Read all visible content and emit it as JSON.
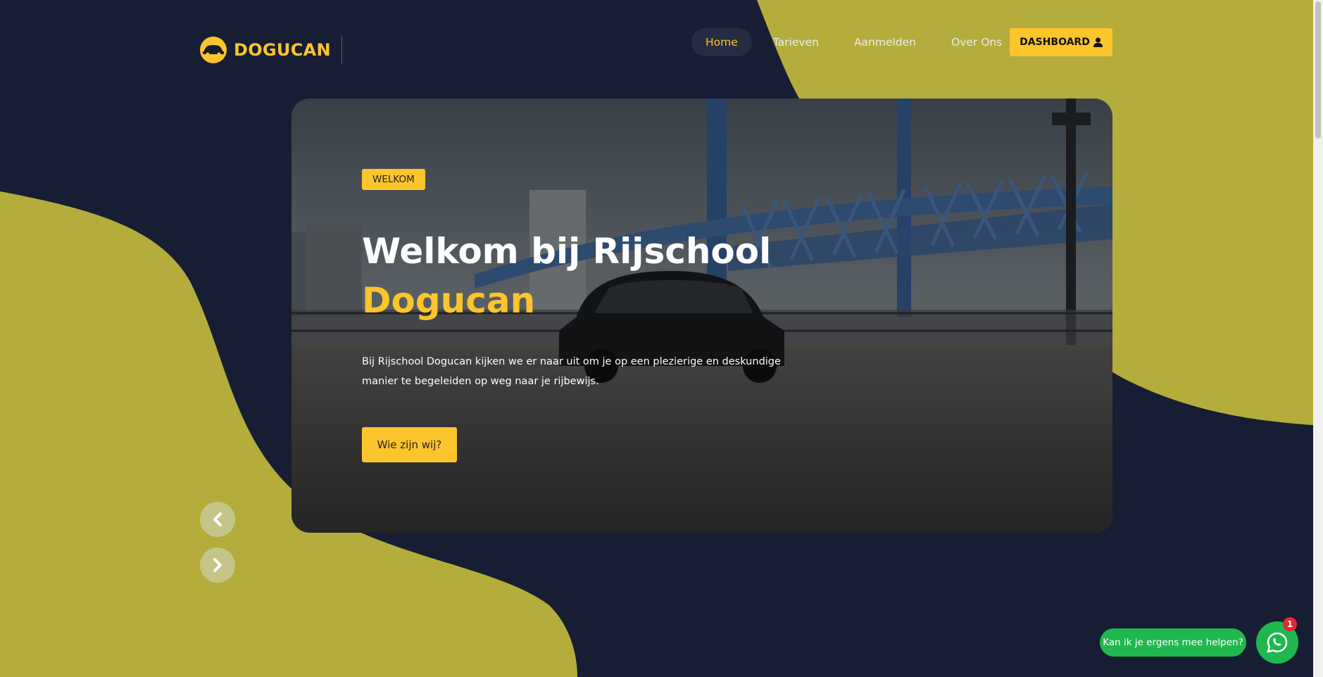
{
  "brand": {
    "name": "DOGUCAN",
    "primary_color": "#fcc52c",
    "olive_color": "#b4ad3b",
    "navy_color": "#171d33"
  },
  "nav": {
    "items": [
      {
        "label": "Home",
        "active": true
      },
      {
        "label": "Tarieven",
        "active": false
      },
      {
        "label": "Aanmelden",
        "active": false
      },
      {
        "label": "Over Ons",
        "active": false
      }
    ],
    "dashboard_label": "DASHBOARD"
  },
  "hero": {
    "badge": "WELKOM",
    "title_line1": "Welkom bij Rijschool",
    "title_line2": "Dogucan",
    "description": "Bij Rijschool Dogucan kijken we er naar uit om je op een plezierige en deskundige manier te begeleiden op weg naar je rijbewijs.",
    "cta_label": "Wie zijn wij?"
  },
  "slider": {
    "prev_icon": "chevron-left-icon",
    "next_icon": "chevron-right-icon"
  },
  "chat": {
    "bubble_text": "Kan ik je ergens mee helpen?",
    "badge_count": "1",
    "icon": "whatsapp-icon"
  }
}
